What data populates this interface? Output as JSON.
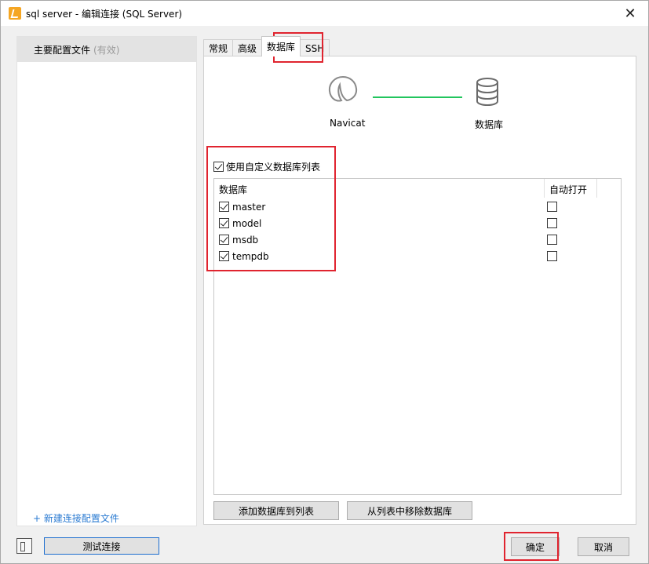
{
  "window": {
    "title": "sql server - 编辑连接 (SQL Server)",
    "close_glyph": "✕"
  },
  "sidebar": {
    "profile_name": "主要配置文件",
    "profile_status": "(有效)",
    "new_profile_link": "+ 新建连接配置文件"
  },
  "tabs": [
    {
      "label": "常规",
      "active": false
    },
    {
      "label": "高级",
      "active": false
    },
    {
      "label": "数据库",
      "active": true
    },
    {
      "label": "SSH",
      "active": false
    }
  ],
  "diagram": {
    "left_label": "Navicat",
    "right_label": "数据库",
    "line_color": "#22c55e"
  },
  "custom_list": {
    "label": "使用自定义数据库列表",
    "checked": true
  },
  "db_table": {
    "col_database": "数据库",
    "col_auto_open": "自动打开",
    "rows": [
      {
        "name": "master",
        "checked": true,
        "auto_open": false
      },
      {
        "name": "model",
        "checked": true,
        "auto_open": false
      },
      {
        "name": "msdb",
        "checked": true,
        "auto_open": false
      },
      {
        "name": "tempdb",
        "checked": true,
        "auto_open": false
      }
    ]
  },
  "buttons": {
    "add_to_list": "添加数据库到列表",
    "remove_from_list": "从列表中移除数据库",
    "test_connection": "测试连接",
    "ok": "确定",
    "cancel": "取消"
  },
  "colors": {
    "annotation_red": "#e0242f",
    "link_blue": "#2b7bd2",
    "focus_blue": "#1e6fd0"
  }
}
